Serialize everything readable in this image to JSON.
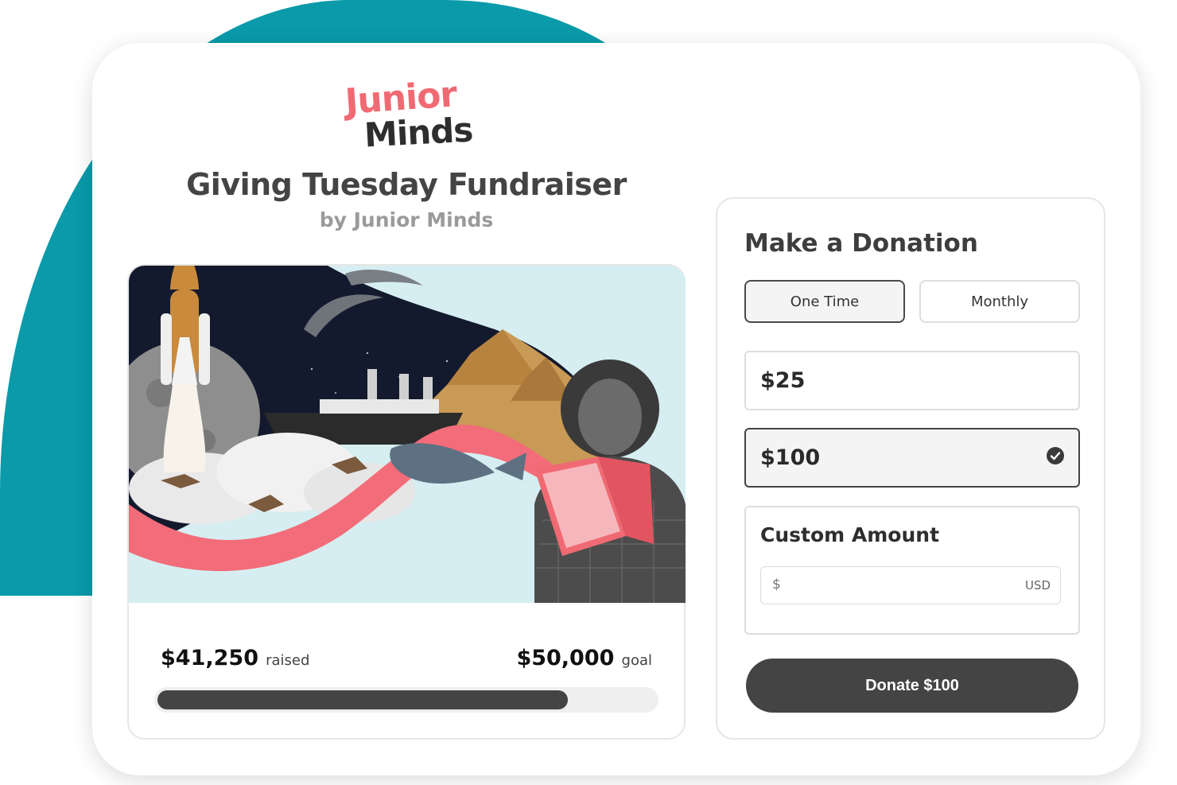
{
  "brand": {
    "logo_line1": "Junior",
    "logo_line2": "Minds",
    "accent_color": "#f06a73",
    "teal_color": "#0a9aa9"
  },
  "campaign": {
    "title": "Giving Tuesday Fundraiser",
    "subtitle": "by Junior Minds",
    "raised_amount": "$41,250",
    "raised_label": "raised",
    "goal_amount": "$50,000",
    "goal_label": "goal",
    "progress_fraction": 0.825
  },
  "donation": {
    "title": "Make a Donation",
    "frequency_options": [
      {
        "label": "One Time",
        "selected": true
      },
      {
        "label": "Monthly",
        "selected": false
      }
    ],
    "amount_options": [
      {
        "label": "$25",
        "selected": false
      },
      {
        "label": "$100",
        "selected": true
      }
    ],
    "custom_amount": {
      "label": "Custom Amount",
      "currency_symbol": "$",
      "currency_code": "USD",
      "value": ""
    },
    "donate_button_label": "Donate $100"
  }
}
